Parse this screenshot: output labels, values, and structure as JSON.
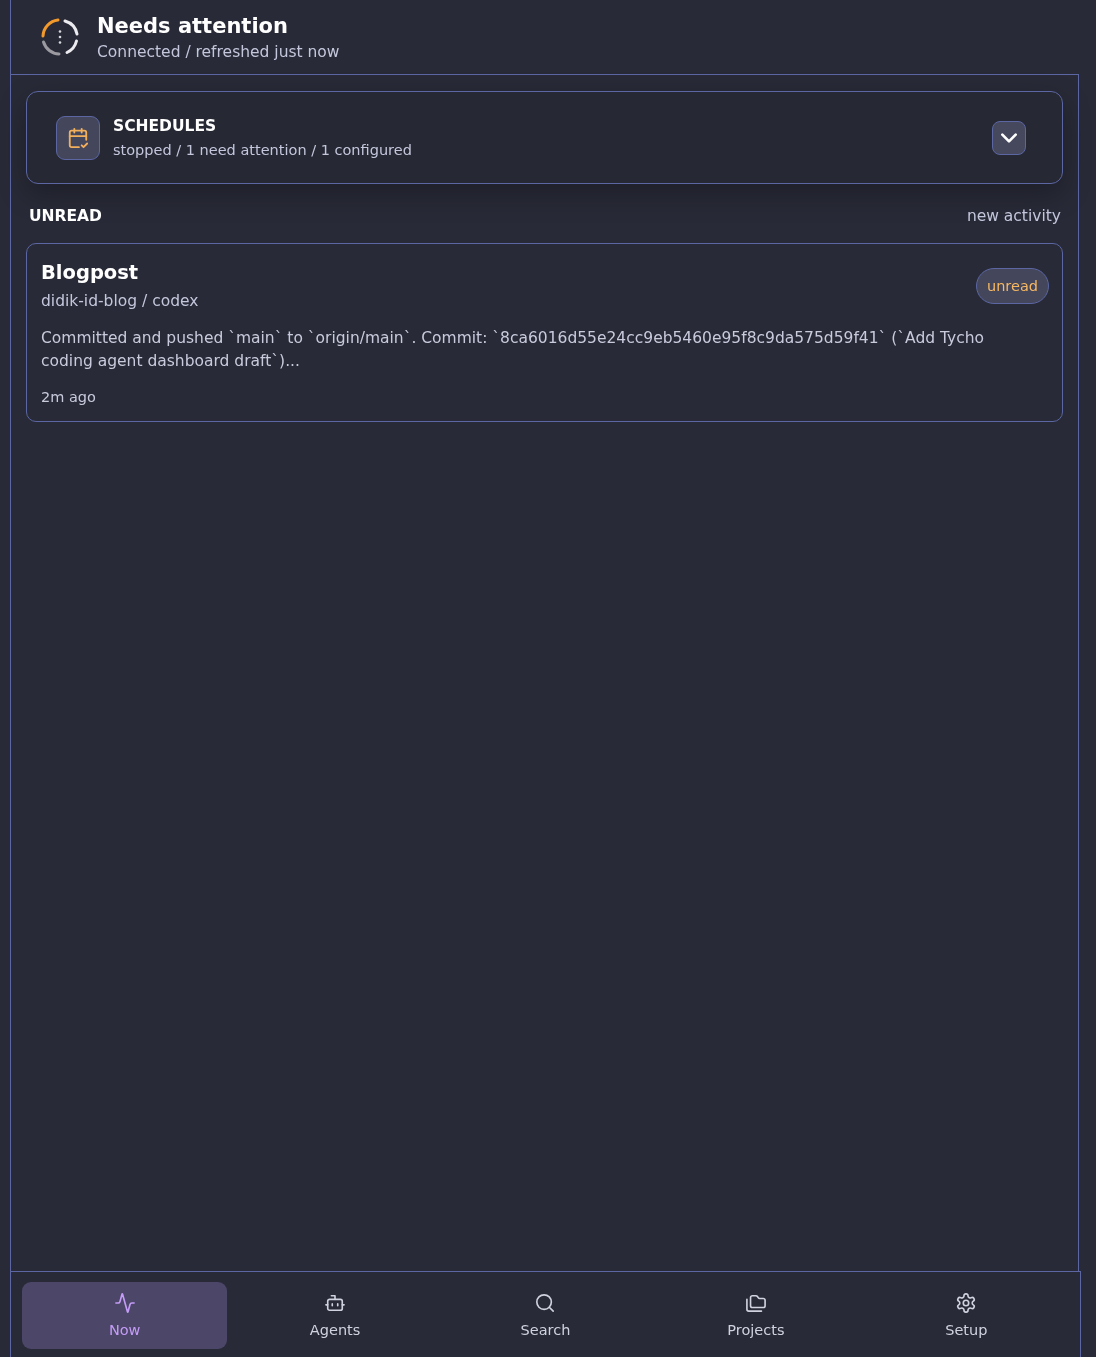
{
  "header": {
    "title": "Needs attention",
    "subtitle": "Connected / refreshed just now"
  },
  "schedules": {
    "title": "SCHEDULES",
    "summary": "stopped / 1 need attention / 1 configured",
    "expanded": false
  },
  "unread": {
    "title": "UNREAD",
    "note": "new activity"
  },
  "items": [
    {
      "title": "Blogpost",
      "project": "didik-id-blog / codex",
      "message": "Committed and pushed `main` to `origin/main`. Commit: `8ca6016d55e24cc9eb5460e95f8c9da575d59f41` (`Add Tycho coding agent dashboard draft`)...",
      "time": "2m ago",
      "badge": "unread"
    }
  ],
  "nav": [
    {
      "label": "Now",
      "kind": "activity",
      "selected": true
    },
    {
      "label": "Agents",
      "kind": "bot",
      "selected": false
    },
    {
      "label": "Search",
      "kind": "search",
      "selected": false
    },
    {
      "label": "Projects",
      "kind": "folders",
      "selected": false
    },
    {
      "label": "Setup",
      "kind": "settings",
      "selected": false
    }
  ]
}
